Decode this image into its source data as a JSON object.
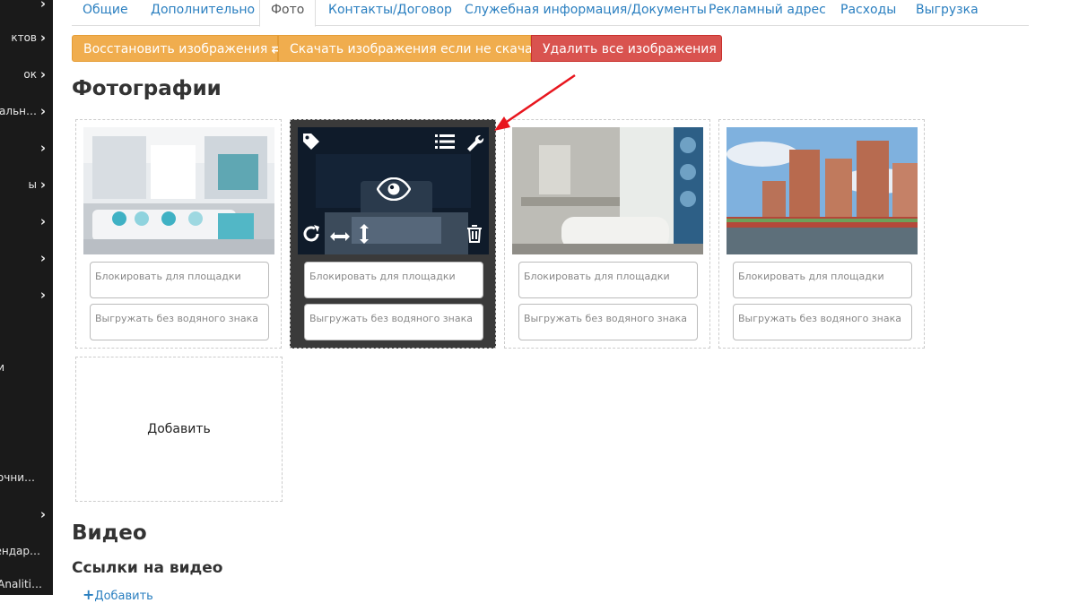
{
  "sidebar": {
    "items": [
      {
        "label": "",
        "chevron": "›"
      },
      {
        "label": "ктов",
        "chevron": "›"
      },
      {
        "label": "ок",
        "chevron": "›"
      },
      {
        "label": "кальн…",
        "chevron": "›"
      },
      {
        "label": "",
        "chevron": "›"
      },
      {
        "label": "ы",
        "chevron": "›"
      },
      {
        "label": "",
        "chevron": "›"
      },
      {
        "label": "",
        "chevron": "›"
      },
      {
        "label": "",
        "chevron": "›"
      },
      {
        "label": "и",
        "chevron": ""
      },
      {
        "label": "очни…",
        "chevron": ""
      },
      {
        "label": "",
        "chevron": "›"
      },
      {
        "label": "ендар…",
        "chevron": ""
      },
      {
        "label": "Analiti…",
        "chevron": ""
      }
    ]
  },
  "tabs": [
    {
      "label": "Общие",
      "active": false
    },
    {
      "label": "Дополнительно",
      "active": false
    },
    {
      "label": "Фото",
      "active": true
    },
    {
      "label": "Контакты/Договор",
      "active": false
    },
    {
      "label": "Служебная информация/Документы",
      "active": false
    },
    {
      "label": "Рекламный адрес",
      "active": false
    },
    {
      "label": "Расходы",
      "active": false
    },
    {
      "label": "Выгрузка",
      "active": false
    }
  ],
  "toolbar": {
    "restore_label": "Восстановить изображения",
    "restore_icon": "⇄",
    "download_label": "Скачать изображения если не скачаны",
    "delete_label": "Удалить все изображения",
    "delete_icon": "🗑"
  },
  "photos_title": "Фотографии",
  "photos": [
    {
      "subject": "living-room",
      "block_placeholder": "Блокировать для площадки",
      "watermark_placeholder": "Выгружать без водяного знака"
    },
    {
      "subject": "bedroom-selected",
      "block_placeholder": "Блокировать для площадки",
      "watermark_placeholder": "Выгружать без водяного знака"
    },
    {
      "subject": "bathroom",
      "block_placeholder": "Блокировать для площадки",
      "watermark_placeholder": "Выгружать без водяного знака"
    },
    {
      "subject": "building-exterior",
      "block_placeholder": "Блокировать для площадки",
      "watermark_placeholder": "Выгружать без водяного знака"
    }
  ],
  "photo_add_label": "Добавить",
  "video_title": "Видео",
  "video_links_title": "Ссылки на видео",
  "video_add_label": "Добавить",
  "colors": {
    "sidebar": "#1a1a1a",
    "link": "#2a7fc0",
    "orange": "#f0ad4e",
    "red": "#d9534f",
    "arrow": "#e8161e"
  },
  "overlay_icons": [
    "tag-icon",
    "list-icon",
    "wrench-icon",
    "eye-icon",
    "rotate-icon",
    "flip-horizontal-icon",
    "flip-vertical-icon",
    "trash-icon"
  ]
}
